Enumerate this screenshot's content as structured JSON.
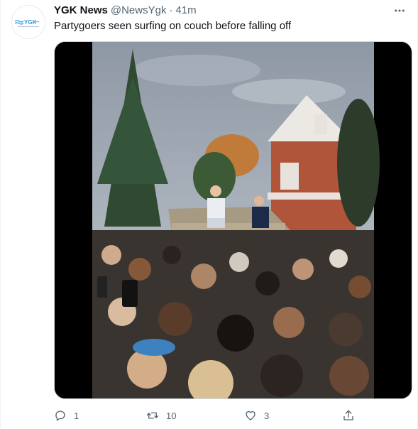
{
  "tweet": {
    "author_name": "YGK News",
    "author_handle": "@NewsYgk",
    "separator": "·",
    "time": "41m",
    "text": "Partygoers seen surfing on couch before falling off",
    "avatar_logo_text": "YGK",
    "avatar_icon": "ygk-news-logo",
    "media_description_icon": "video-thumbnail",
    "more_icon": "more-horizontal-icon"
  },
  "actions": {
    "reply": {
      "icon": "reply-icon",
      "count": "1"
    },
    "retweet": {
      "icon": "retweet-icon",
      "count": "10"
    },
    "like": {
      "icon": "like-icon",
      "count": "3"
    },
    "share": {
      "icon": "share-icon"
    }
  },
  "colors": {
    "text_primary": "#0f1419",
    "text_secondary": "#536471",
    "border": "#cfd9de",
    "logo_blue": "#1d9bf0"
  }
}
